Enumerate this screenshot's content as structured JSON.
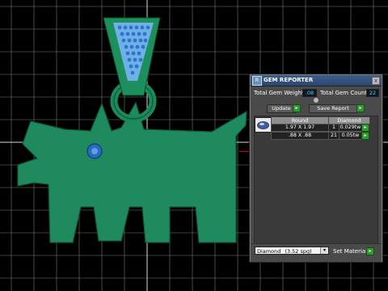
{
  "panel": {
    "title": "GEM REPORTER",
    "close_label": "x",
    "logo_label": "R",
    "total_gem_weight_label": "Total Gem Weight",
    "total_gem_weight_value": ".08",
    "total_gem_count_label": "Total Gem Count",
    "total_gem_count_value": "22",
    "update_label": "Update",
    "save_report_label": "Save Report",
    "table": {
      "headers": [
        "Round",
        "Diamond"
      ],
      "rows": [
        {
          "size": "1.97 X 1.97",
          "count": "1",
          "weight": "0.029tw"
        },
        {
          "size": ".88 X .88",
          "count": "21",
          "weight": "0.05tw"
        }
      ]
    },
    "material_select_value": "Diamond",
    "material_select_detail": "(3.52 spg)",
    "set_material_label": "Set Material"
  },
  "colors": {
    "model_green": "#1f8a5e",
    "gem_blue": "#2a6bc2",
    "grid": "#ffffff",
    "panel_bg": "#4a4a4a"
  }
}
